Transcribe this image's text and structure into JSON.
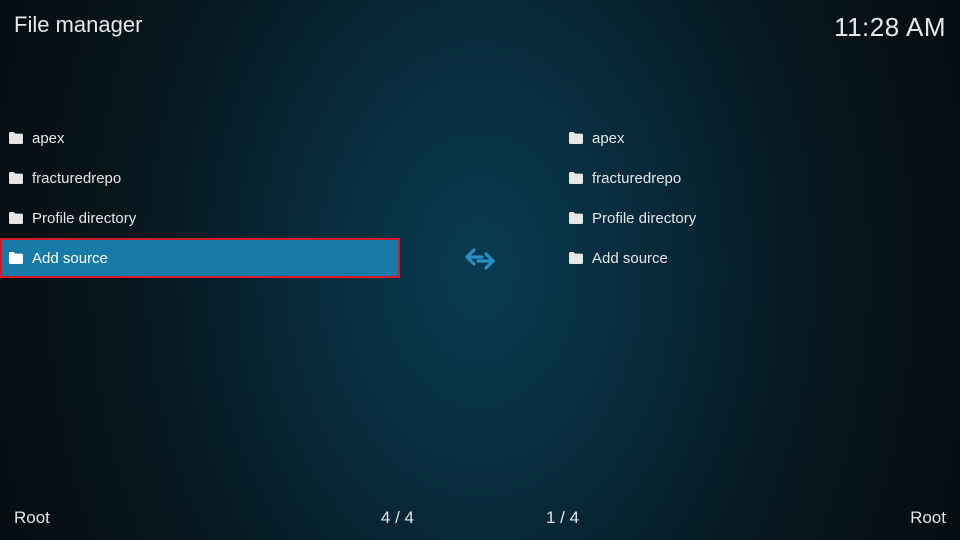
{
  "header": {
    "title": "File manager",
    "clock": "11:28 AM"
  },
  "leftPane": {
    "items": [
      {
        "label": "apex",
        "icon": "folder-icon",
        "selected": false
      },
      {
        "label": "fracturedrepo",
        "icon": "folder-icon",
        "selected": false
      },
      {
        "label": "Profile directory",
        "icon": "folder-icon",
        "selected": false
      },
      {
        "label": "Add source",
        "icon": "folder-icon",
        "selected": true
      }
    ],
    "footer": {
      "path": "Root",
      "position": "4 / 4"
    }
  },
  "rightPane": {
    "items": [
      {
        "label": "apex",
        "icon": "folder-icon",
        "selected": false
      },
      {
        "label": "fracturedrepo",
        "icon": "folder-icon",
        "selected": false
      },
      {
        "label": "Profile directory",
        "icon": "folder-icon",
        "selected": false
      },
      {
        "label": "Add source",
        "icon": "folder-icon",
        "selected": false
      }
    ],
    "footer": {
      "path": "Root",
      "position": "1 / 4"
    }
  },
  "transferIcon": "↔"
}
